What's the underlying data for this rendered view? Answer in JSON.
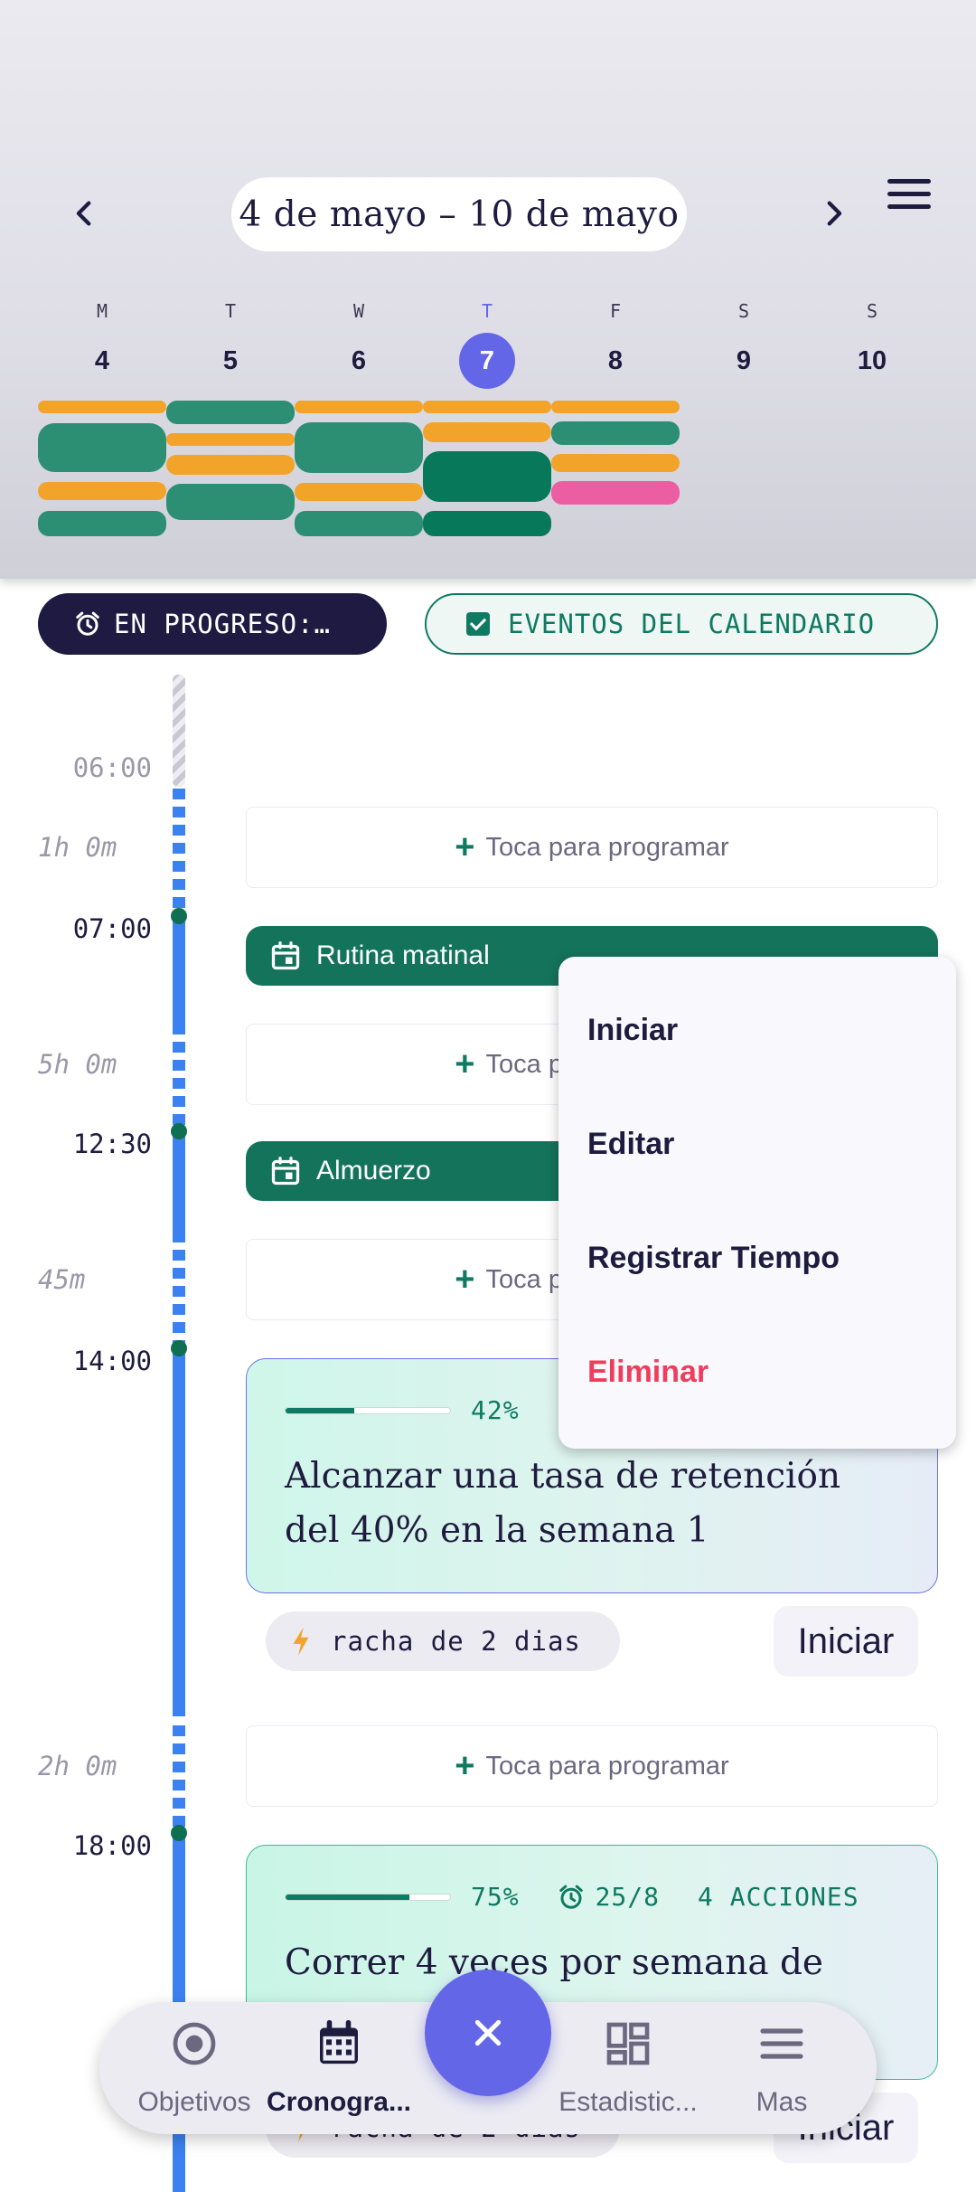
{
  "header": {
    "date_range": "4 de mayo – 10 de mayo",
    "days": [
      {
        "letter": "M",
        "num": "4"
      },
      {
        "letter": "T",
        "num": "5"
      },
      {
        "letter": "W",
        "num": "6"
      },
      {
        "letter": "T",
        "num": "7",
        "today": true
      },
      {
        "letter": "F",
        "num": "8"
      },
      {
        "letter": "S",
        "num": "9"
      },
      {
        "letter": "S",
        "num": "10"
      }
    ],
    "icons": {
      "prev": "chevron-left-icon",
      "next": "chevron-right-icon",
      "menu": "hamburger-menu-icon"
    }
  },
  "chips": {
    "in_progress": "EN PROGRESO:…",
    "calendar_events": "EVENTOS DEL CALENDARIO"
  },
  "timeline": {
    "times": [
      "06:00",
      "07:00",
      "12:30",
      "14:00",
      "18:00"
    ],
    "durations": [
      "1h 0m",
      "5h 0m",
      "45m",
      "2h 0m"
    ],
    "slot_label": "Toca para programar",
    "events": [
      "Rutina matinal",
      "Almuerzo"
    ],
    "goal1": {
      "percent": "42%",
      "progress": 0.42,
      "title": "Alcanzar una tasa de retención del 40% en la semana 1",
      "streak": "racha de 2 dias",
      "start": "Iniciar"
    },
    "goal2": {
      "percent": "75%",
      "progress": 0.75,
      "due": "25/8",
      "actions": "4 ACCIONES",
      "title": "Correr 4 veces por semana de",
      "streak": "racha de 2 dias",
      "start": "Iniciar"
    }
  },
  "context_menu": {
    "start": "Iniciar",
    "edit": "Editar",
    "log_time": "Registrar Tiempo",
    "delete": "Eliminar"
  },
  "bottom_nav": {
    "goals": "Objetivos",
    "schedule": "Cronogra...",
    "stats": "Estadistic...",
    "more": "Mas",
    "active": "schedule"
  },
  "colors": {
    "accent": "#6466e8",
    "primary_green": "#0f7a62",
    "timeline_blue": "#3b82f0",
    "bar_yellow": "#f2a42a",
    "bar_green": "#2c8f73",
    "bar_pink": "#ec5ea2",
    "danger": "#ef3e5b"
  }
}
